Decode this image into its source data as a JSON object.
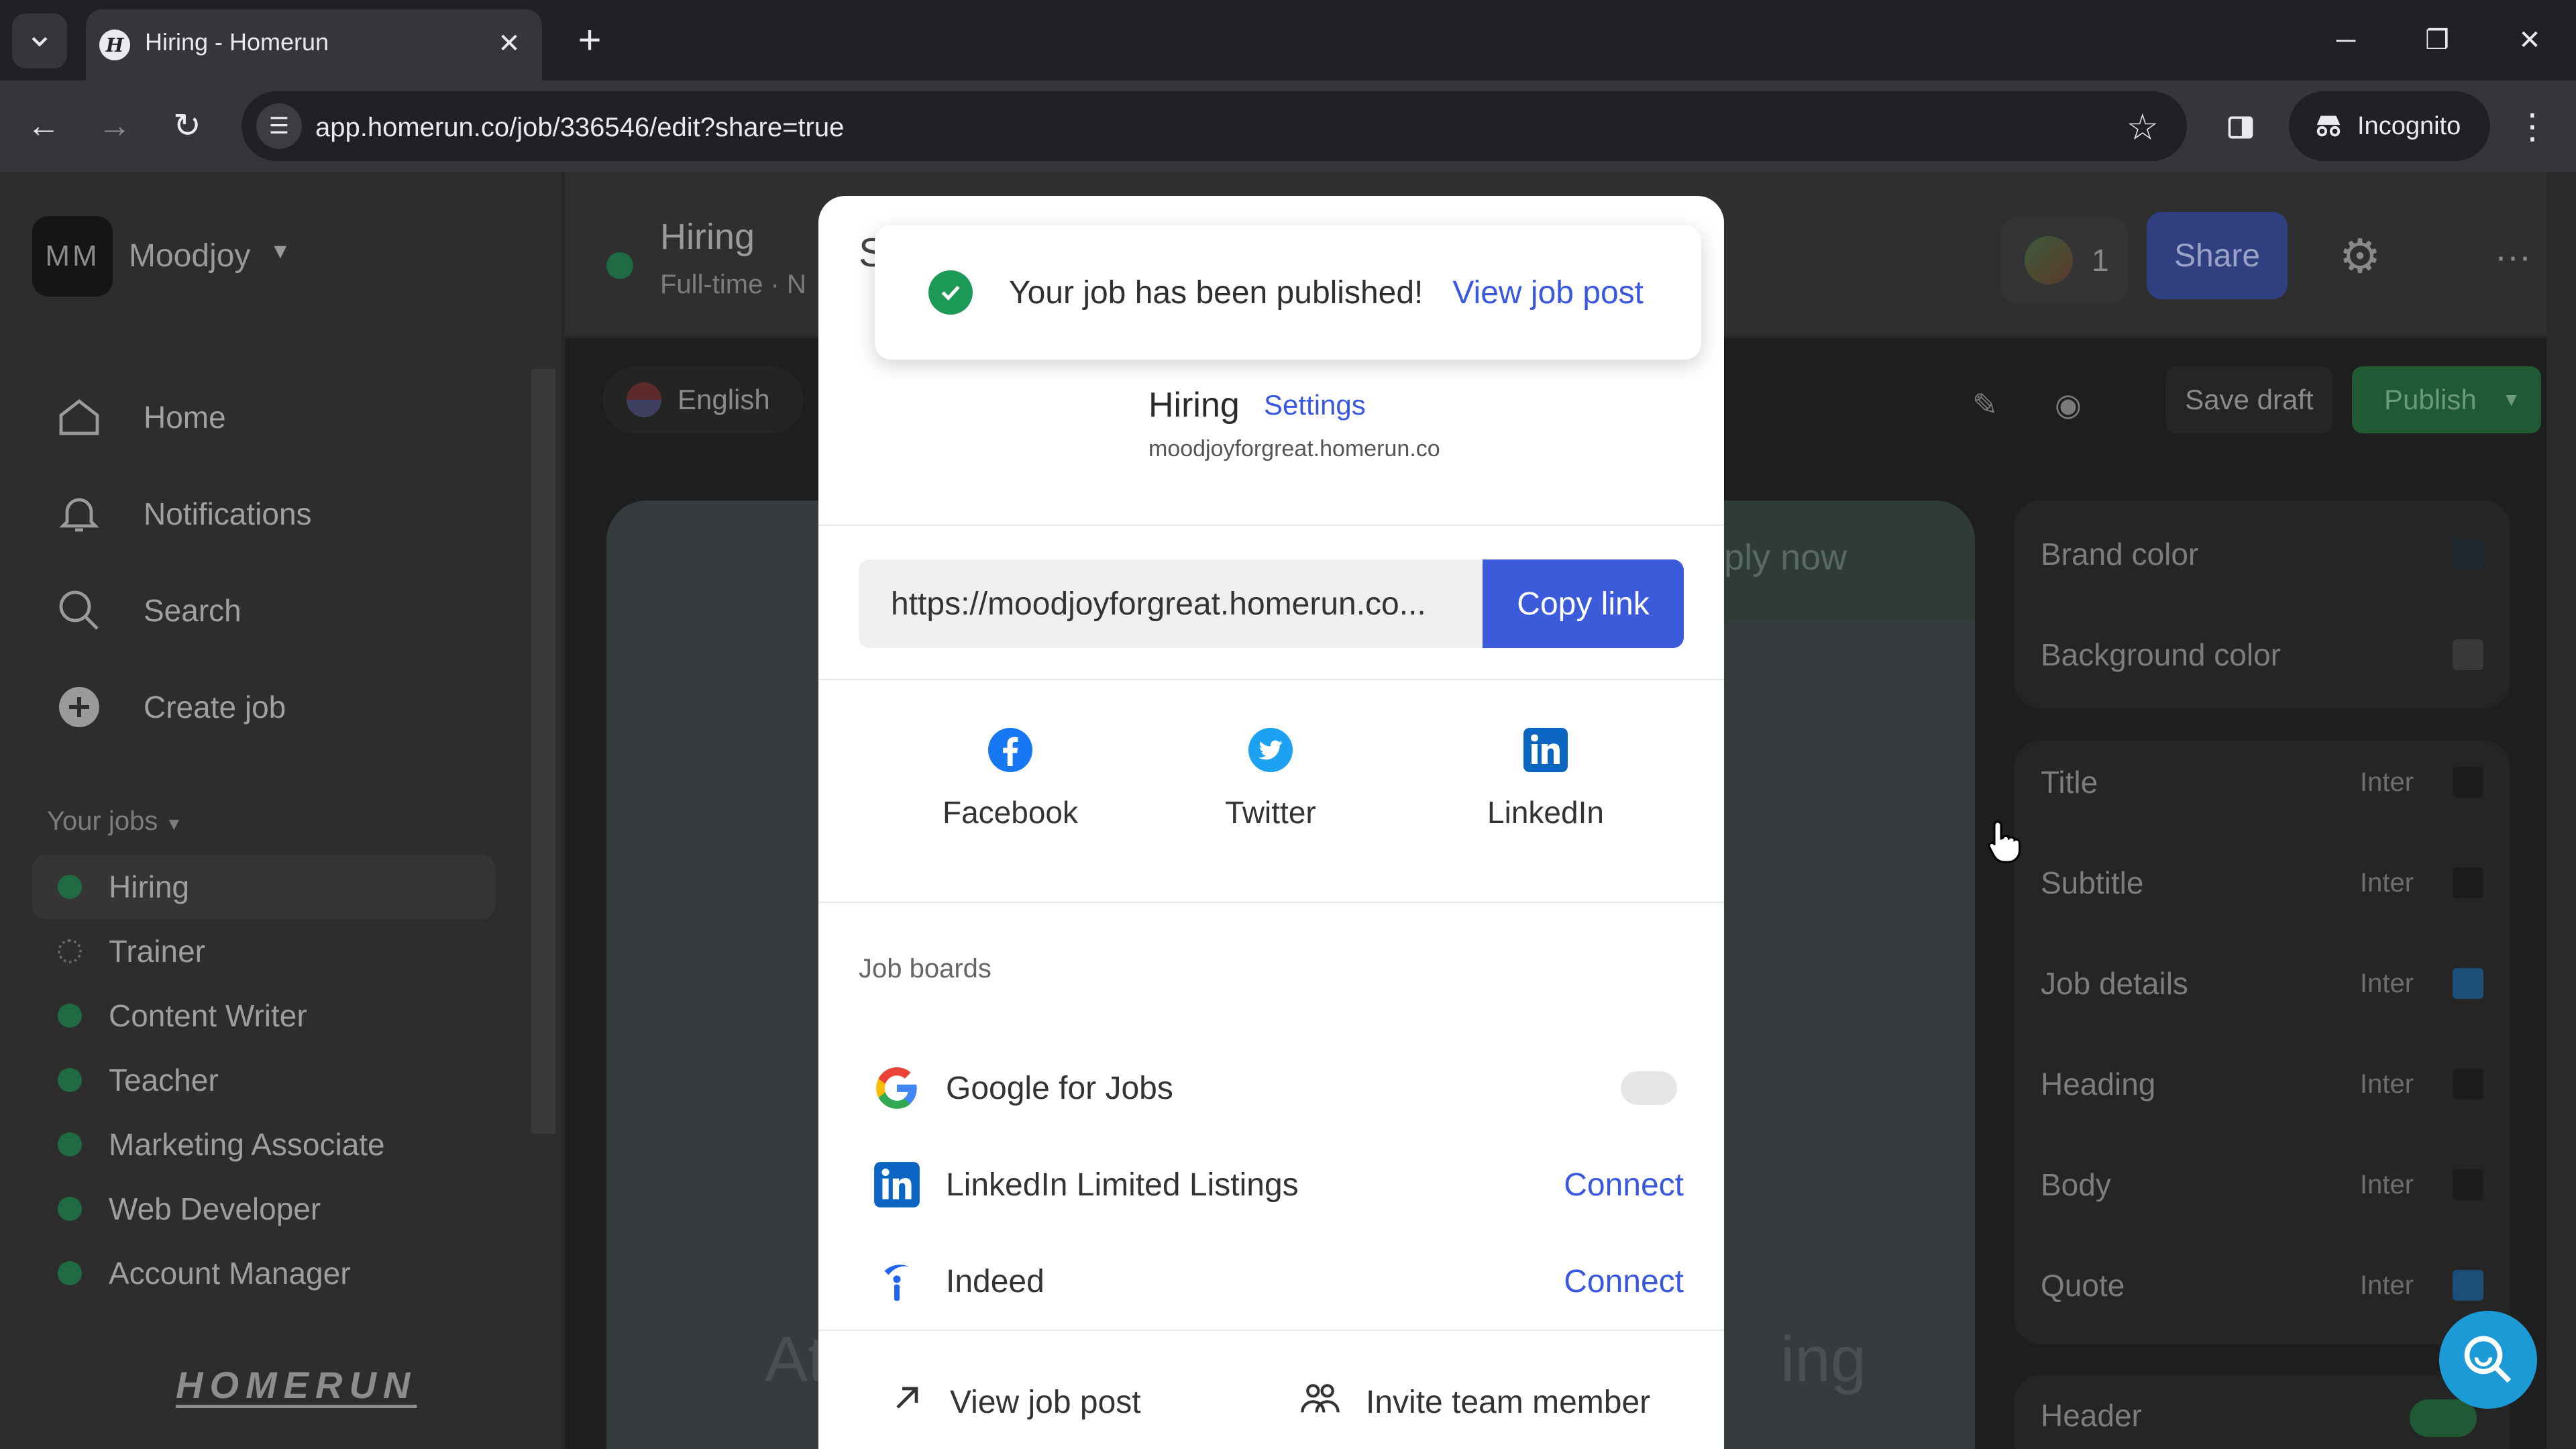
{
  "browser": {
    "tab_title": "Hiring - Homerun",
    "url": "app.homerun.co/job/336546/edit?share=true",
    "incognito_label": "Incognito"
  },
  "sidebar": {
    "workspace_initials": "MM",
    "workspace_name": "Moodjoy",
    "nav": [
      {
        "label": "Home",
        "icon": "home-icon"
      },
      {
        "label": "Notifications",
        "icon": "bell-icon"
      },
      {
        "label": "Search",
        "icon": "search-icon"
      },
      {
        "label": "Create job",
        "icon": "plus-circle-icon"
      }
    ],
    "your_jobs_label": "Your jobs",
    "jobs": [
      {
        "label": "Hiring",
        "status": "published",
        "active": true
      },
      {
        "label": "Trainer",
        "status": "draft",
        "active": false
      },
      {
        "label": "Content Writer",
        "status": "published",
        "active": false
      },
      {
        "label": "Teacher",
        "status": "published",
        "active": false
      },
      {
        "label": "Marketing Associate",
        "status": "published",
        "active": false
      },
      {
        "label": "Web Developer",
        "status": "published",
        "active": false
      },
      {
        "label": "Account Manager",
        "status": "published",
        "active": false
      }
    ],
    "logo_text": "HOMERUN"
  },
  "topbar": {
    "job_title": "Hiring",
    "job_subtitle": "Full-time · N",
    "viewers_count": "1",
    "share_label": "Share"
  },
  "editor": {
    "language": "English",
    "save_draft_label": "Save draft",
    "publish_label": "Publish",
    "apply_now_label": "Apply now",
    "preview_heading_left": "At",
    "preview_heading_right": "ing"
  },
  "style_panel": {
    "colors": [
      {
        "label": "Brand color",
        "swatch": "#1e2a2f"
      },
      {
        "label": "Background color",
        "swatch": "#3a3a3a"
      }
    ],
    "typography": [
      {
        "label": "Title",
        "font": "Inter",
        "swatch": "#1c1c1c"
      },
      {
        "label": "Subtitle",
        "font": "Inter",
        "swatch": "#1c1c1c"
      },
      {
        "label": "Job details",
        "font": "Inter",
        "swatch": "#1b4f7a"
      },
      {
        "label": "Heading",
        "font": "Inter",
        "swatch": "#1c1c1c"
      },
      {
        "label": "Body",
        "font": "Inter",
        "swatch": "#1c1c1c"
      },
      {
        "label": "Quote",
        "font": "Inter",
        "swatch": "#1b4f7a"
      }
    ],
    "header_label": "Header"
  },
  "modal": {
    "hidden_title_initial": "S",
    "toast": {
      "message": "Your job has been published!",
      "link": "View job post"
    },
    "page_title": "Hiring",
    "settings_link": "Settings",
    "domain": "moodjoyforgreat.homerun.co",
    "share_link": "https://moodjoyforgreat.homerun.co...",
    "copy_link_label": "Copy link",
    "social": [
      {
        "label": "Facebook",
        "icon": "facebook-icon",
        "color": "#1877f2"
      },
      {
        "label": "Twitter",
        "icon": "twitter-icon",
        "color": "#1da1f2"
      },
      {
        "label": "LinkedIn",
        "icon": "linkedin-icon",
        "color": "#0a66c2"
      }
    ],
    "job_boards_title": "Job boards",
    "job_boards": [
      {
        "label": "Google for Jobs",
        "action": ""
      },
      {
        "label": "LinkedIn Limited Listings",
        "action": "Connect"
      },
      {
        "label": "Indeed",
        "action": "Connect"
      }
    ],
    "footer": {
      "view_job_post": "View job post",
      "invite_team_member": "Invite team member"
    }
  },
  "colors": {
    "accent_blue": "#3b5bdb",
    "success_green": "#1e9a58",
    "link_blue": "#3a57e0"
  }
}
